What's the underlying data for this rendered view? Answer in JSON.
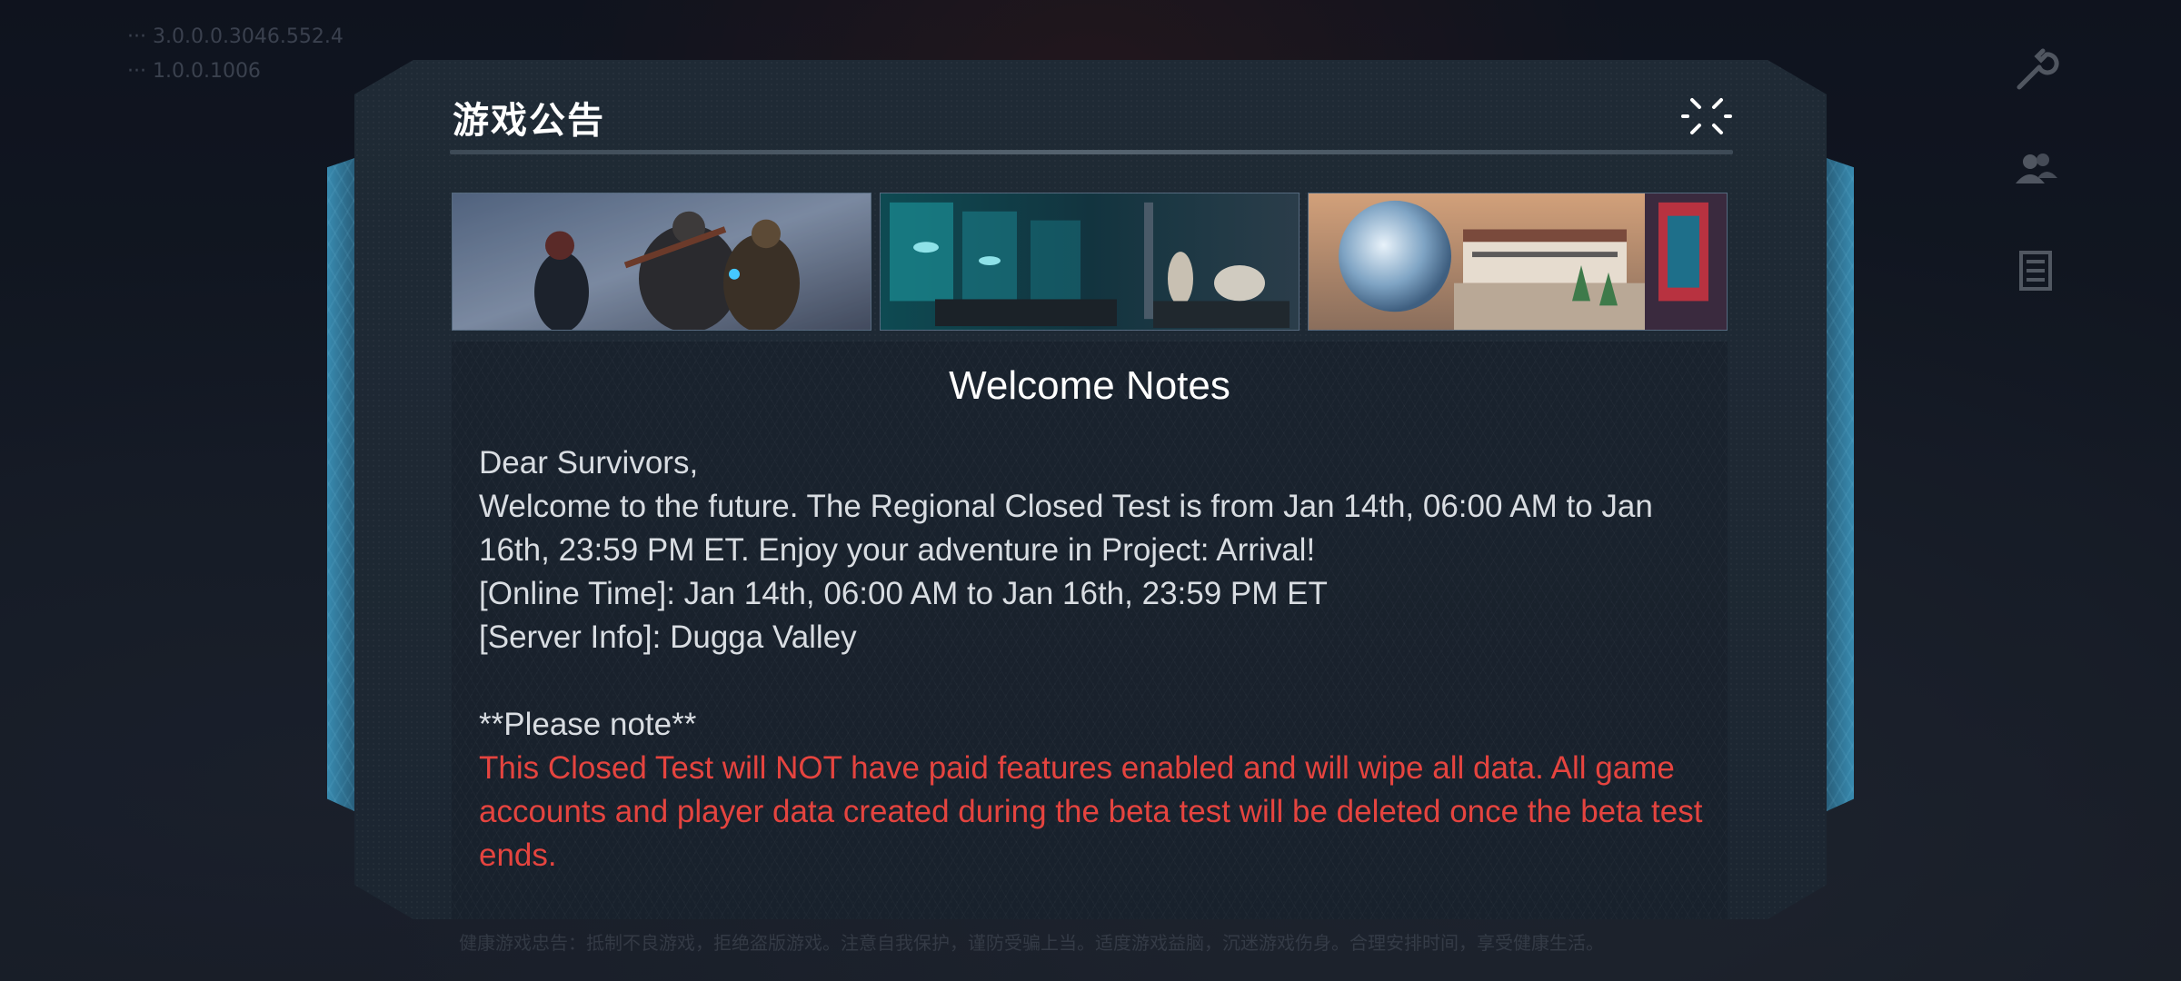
{
  "background": {
    "top_left_lines": [
      "··· 3.0.0.0.3046.552.4",
      "··· 1.0.0.1006"
    ],
    "footer_text": "健康游戏忠告：抵制不良游戏，拒绝盗版游戏。注意自我保护，谨防受骗上当。适度游戏益脑，沉迷游戏伤身。合理安排时间，享受健康生活。",
    "right_icons": [
      "wrench-icon",
      "friends-icon",
      "list-icon"
    ]
  },
  "dialog": {
    "title": "游戏公告",
    "close_icon": "close-icon",
    "banners": [
      {
        "name": "survivors-banner"
      },
      {
        "name": "lab-banner"
      },
      {
        "name": "city-dome-banner"
      }
    ],
    "notice": {
      "heading": "Welcome Notes",
      "greeting": "Dear Survivors,",
      "intro": "Welcome to the future. The Regional Closed Test is from Jan 14th, 06:00 AM to Jan 16th, 23:59 PM ET. Enjoy your adventure in Project: Arrival!",
      "online_time": "[Online Time]: Jan 14th, 06:00 AM to Jan 16th, 23:59 PM ET",
      "server_info": "[Server Info]: Dugga Valley",
      "note_header": "**Please note**",
      "warning": "This Closed Test will NOT have paid features enabled and will wipe all data. All game accounts and player data created during the beta test will be deleted once the beta test ends."
    }
  },
  "colors": {
    "warning": "#e5443f",
    "accent_frame": "#3c96be"
  }
}
